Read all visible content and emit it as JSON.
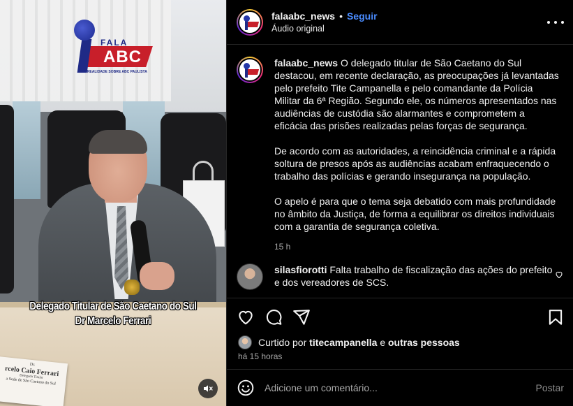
{
  "colors": {
    "background": "#000000",
    "text": "#f5f5f5",
    "muted": "#a8a8a8",
    "accent_follow": "#4a8cff",
    "divider": "#262626"
  },
  "media": {
    "caption_line1": "Delegado Titular de São Caetano do Sul",
    "caption_line2": "Dr Marcelo Ferrari",
    "logo_top": "FALA",
    "logo_main": "ABC",
    "logo_tagline": "A REALIDADE SOBRE ABC PAULISTA",
    "nameplate": {
      "line1": "Dr.",
      "line2": "rcelo Caio Ferrari",
      "line3": "Delegado Titular",
      "line4": "a Sede de São Caetano do Sul"
    },
    "mute_icon": "speaker-muted-icon"
  },
  "header": {
    "username": "falaabc_news",
    "separator": "•",
    "follow_label": "Seguir",
    "subtitle": "Áudio original",
    "more_icon": "more-dots-icon"
  },
  "post": {
    "username": "falaabc_news",
    "paragraph1": "O delegado titular de São Caetano do Sul destacou, em recente declaração, as preocupações já levantadas pelo prefeito Tite Campanella e pelo comandante da Polícia Militar da 6ª Região. Segundo ele, os números apresentados nas audiências de custódia são alarmantes e comprometem a eficácia das prisões realizadas pelas forças de segurança.",
    "paragraph2": "De acordo com as autoridades, a reincidência criminal e a rápida soltura de presos após as audiências acabam enfraquecendo o trabalho das polícias e gerando insegurança na população.",
    "paragraph3": "O apelo é para que o tema seja debatido com mais profundidade no âmbito da Justiça, de forma a equilibrar os direitos individuais com a garantia de segurança coletiva.",
    "time_ago": "15 h"
  },
  "comment": {
    "username": "silasfiorotti",
    "text": "Falta trabalho de fiscalização das ações do prefeito e dos vereadores de SCS.",
    "icon": "heart-outline-icon"
  },
  "actions": {
    "icons": [
      "heart-icon",
      "comment-icon",
      "share-icon",
      "bookmark-icon"
    ]
  },
  "likes": {
    "prefix": "Curtido por",
    "user": "titecampanella",
    "joiner": "e",
    "others": "outras pessoas"
  },
  "timestamp": "há 15 horas",
  "add_comment": {
    "placeholder": "Adicione um comentário...",
    "post_label": "Postar",
    "emoji_icon": "emoji-icon"
  }
}
